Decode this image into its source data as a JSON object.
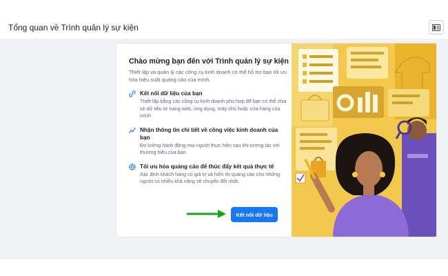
{
  "header": {
    "title": "Tổng quan về Trình quản lý sự kiện",
    "view_toggle_icon": "layout-toggle-icon"
  },
  "welcome": {
    "title": "Chào mừng bạn đến với Trình quản lý sự kiện",
    "description": "Thiết lập và quản lý các công cụ kinh doanh có thể hỗ trợ bạn tối ưu hóa hiệu suất quảng cáo của mình.",
    "features": [
      {
        "icon": "link-icon",
        "title": "Kết nối dữ liệu của bạn",
        "description": "Thiết lập bằng các công cụ kinh doanh phù hợp để bạn có thể chia sẻ dữ liệu từ trang web, ứng dụng, máy chủ hoặc cửa hàng của mình"
      },
      {
        "icon": "insights-icon",
        "title": "Nhận thông tin chi tiết về công việc kinh doanh của bạn",
        "description": "Đo lường hành động mọi người thực hiện sau khi tương tác với thương hiệu của bạn."
      },
      {
        "icon": "target-icon",
        "title": "Tối ưu hóa quảng cáo để thúc đẩy kết quả thực tế",
        "description": "Xác định khách hàng có giá trị và hiển thị quảng cáo cho những người có nhiều khả năng sẽ chuyển đổi nhất."
      }
    ],
    "connect_button": "Kết nối dữ liệu"
  },
  "colors": {
    "accent": "#1877f2",
    "arrow": "#19a319",
    "illustration_bg": "#f2c94c",
    "purple": "#6b4fbb"
  }
}
